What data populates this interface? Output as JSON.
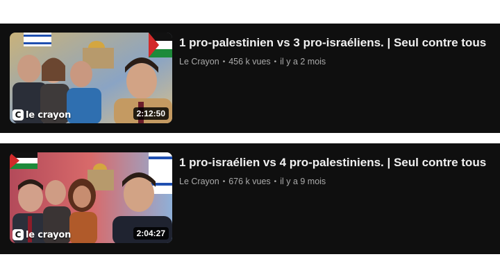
{
  "videos": [
    {
      "title": "1 pro-palestinien vs 3 pro-israéliens. | Seul contre tous",
      "channel": "Le Crayon",
      "views": "456 k vues",
      "age": "il y a 2 mois",
      "duration": "2:12:50",
      "logo_mark": "C",
      "logo_text": "le crayon"
    },
    {
      "title": "1 pro-israélien vs 4 pro-palestiniens. | Seul contre tous",
      "channel": "Le Crayon",
      "views": "676 k vues",
      "age": "il y a 9 mois",
      "duration": "2:04:27",
      "logo_mark": "C",
      "logo_text": "le crayon"
    }
  ],
  "separator": "•",
  "colors": {
    "card_bg": "#0f0f0f",
    "title": "#f1f1f1",
    "meta": "#aaaaaa",
    "page_bg": "#ffffff"
  }
}
